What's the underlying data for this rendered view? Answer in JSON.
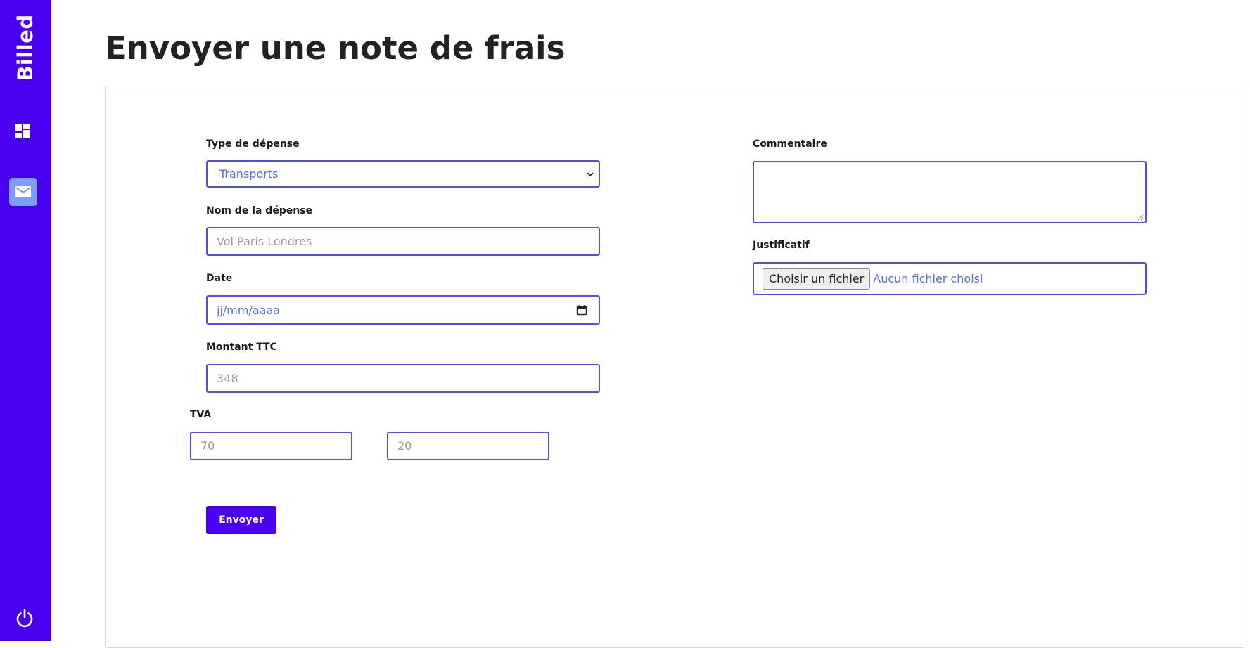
{
  "app": {
    "brand": "Billed"
  },
  "sidebar": {
    "items": [
      {
        "icon": "dashboard-icon"
      },
      {
        "icon": "mail-icon",
        "active": true
      },
      {
        "icon": "power-icon"
      }
    ]
  },
  "page": {
    "title": "Envoyer une note de frais"
  },
  "form": {
    "expense_type": {
      "label": "Type de dépense",
      "selected": "Transports"
    },
    "expense_name": {
      "label": "Nom de la dépense",
      "placeholder": "Vol Paris Londres"
    },
    "date": {
      "label": "Date",
      "placeholder": "jj/mm/aaaa"
    },
    "amount": {
      "label": "Montant TTC",
      "placeholder": "348"
    },
    "tva": {
      "label": "TVA",
      "amount_placeholder": "70",
      "percent_placeholder": "20"
    },
    "comment": {
      "label": "Commentaire",
      "value": ""
    },
    "proof": {
      "label": "Justificatif",
      "button_label": "Choisir un fichier",
      "status": "Aucun fichier choisi"
    },
    "submit_label": "Envoyer"
  },
  "colors": {
    "sidebar": "#4a00f0",
    "accent": "#4b50e6",
    "active_icon_bg": "#7e9cff",
    "submit": "#4a00f0"
  }
}
